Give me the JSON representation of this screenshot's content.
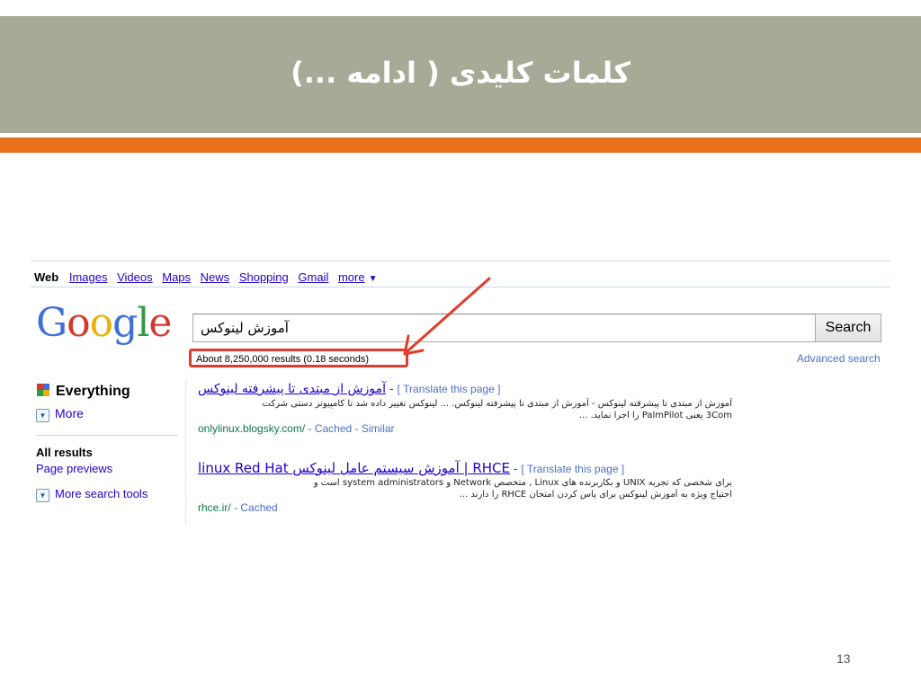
{
  "slide": {
    "title": "کلمات کلیدی ( ادامه ...)",
    "page_number": "13",
    "colors": {
      "header": "#a6aa96",
      "accent_bar": "#e8711c",
      "highlight": "#e23b2b"
    }
  },
  "google": {
    "nav": {
      "web": "Web",
      "links": [
        "Images",
        "Videos",
        "Maps",
        "News",
        "Shopping",
        "Gmail",
        "more"
      ],
      "more_arrow": "▼"
    },
    "logo": [
      "G",
      "o",
      "o",
      "g",
      "l",
      "e"
    ],
    "search": {
      "query": "آموزش لینوکس",
      "button": "Search"
    },
    "results_count": "About 8,250,000 results (0.18 seconds)",
    "advanced_search": "Advanced search",
    "sidebar": {
      "everything": "Everything",
      "more": "More",
      "all_results": "All results",
      "page_previews": "Page previews",
      "more_search_tools": "More search tools"
    },
    "results": [
      {
        "title": "آموزش از مبتدی تا پیشرفته لینوکس",
        "separator": " - ",
        "translate": "[ Translate this page ]",
        "snippet_lines": [
          "آموزش از مبتدی تا پیشرفته لینوکس - آموزش از مبتدی تا پیشرفته لینوکس. ... لینوکس تغییر داده شد تا کامپیوتر دستی شرکت",
          "3Com یعنی PalmPilot را اجرا نماید. ..."
        ],
        "url": "onlylinux.blogsky.com/",
        "cache_links": " - Cached - Similar"
      },
      {
        "title": "linux Red Hat آموزش سیستم عامل لینوکس | RHCE",
        "separator": " - ",
        "translate": "[ Translate this page ]",
        "snippet_lines": [
          "برای شخصی که تجربه UNIX و بکاربرنده های Linux , متخصص Network و system administrators است و",
          "احتیاج ویژه به آموزش لینوکس برای پاس کردن امتحان RHCE را دارند ..."
        ],
        "url": "rhce.ir/",
        "cache_links": " - Cached"
      }
    ]
  }
}
